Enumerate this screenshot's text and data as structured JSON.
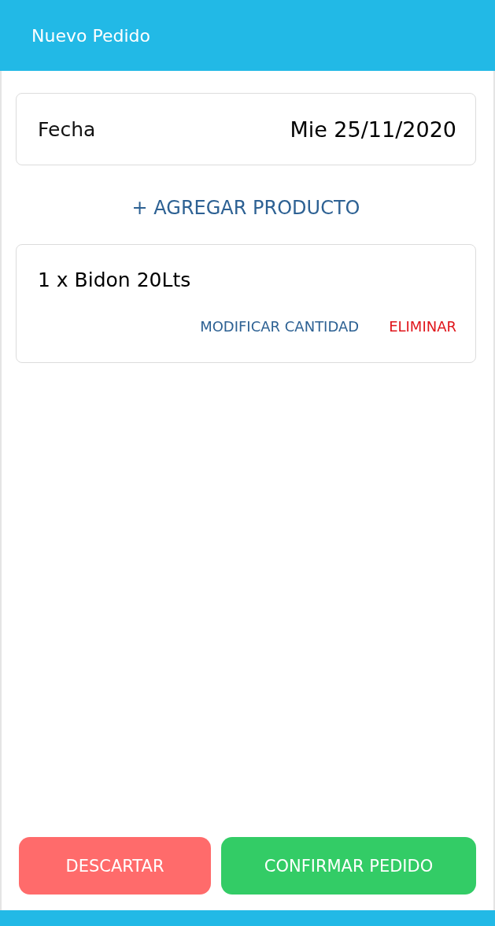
{
  "header": {
    "title": "Nuevo Pedido"
  },
  "date_field": {
    "label": "Fecha",
    "value": "Mie 25/11/2020"
  },
  "add_product": "+ AGREGAR PRODUCTO",
  "items": [
    {
      "text": "1 x Bidon 20Lts",
      "actions": [
        {
          "kind": "modify",
          "label": "MODIFICAR CANTIDAD"
        },
        {
          "kind": "delete",
          "label": "ELIMINAR"
        }
      ]
    }
  ],
  "buttons": [
    {
      "kind": "discard",
      "label": "DESCARTAR"
    },
    {
      "kind": "confirm",
      "label": "CONFIRMAR PEDIDO"
    }
  ]
}
